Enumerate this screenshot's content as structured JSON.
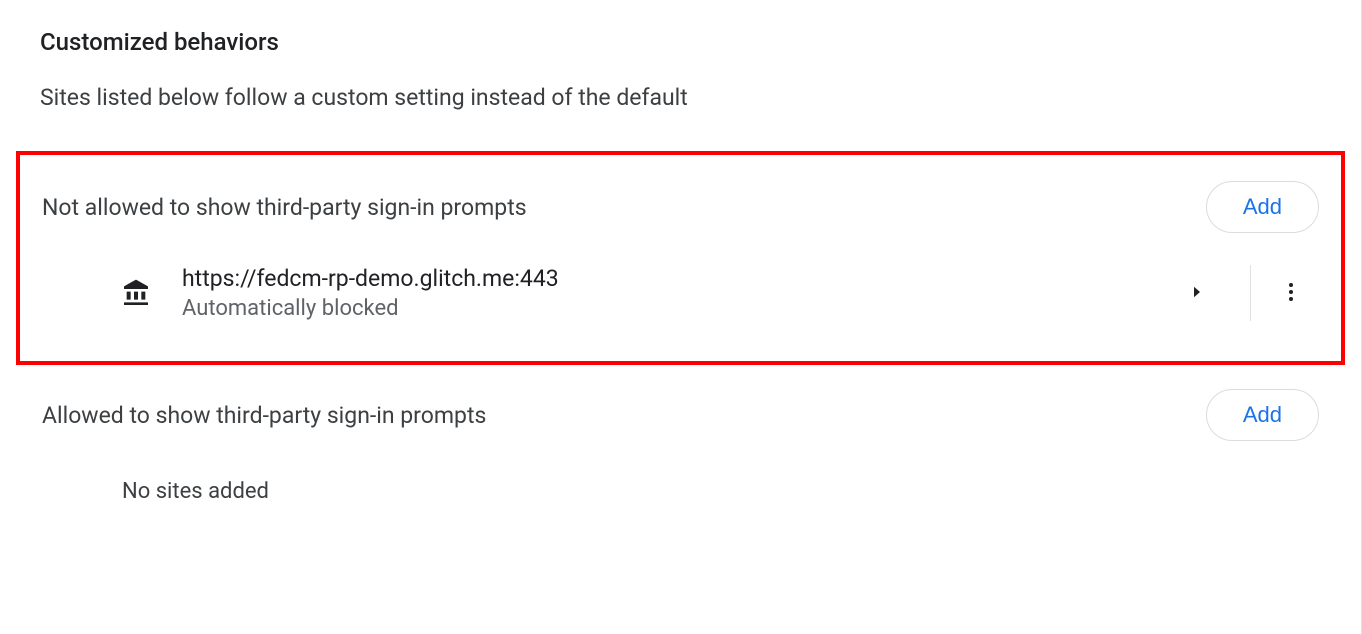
{
  "title": "Customized behaviors",
  "subtitle": "Sites listed below follow a custom setting instead of the default",
  "not_allowed": {
    "heading": "Not allowed to show third-party sign-in prompts",
    "add_label": "Add",
    "sites": [
      {
        "url": "https://fedcm-rp-demo.glitch.me:443",
        "status": "Automatically blocked"
      }
    ]
  },
  "allowed": {
    "heading": "Allowed to show third-party sign-in prompts",
    "add_label": "Add",
    "empty_text": "No sites added"
  }
}
